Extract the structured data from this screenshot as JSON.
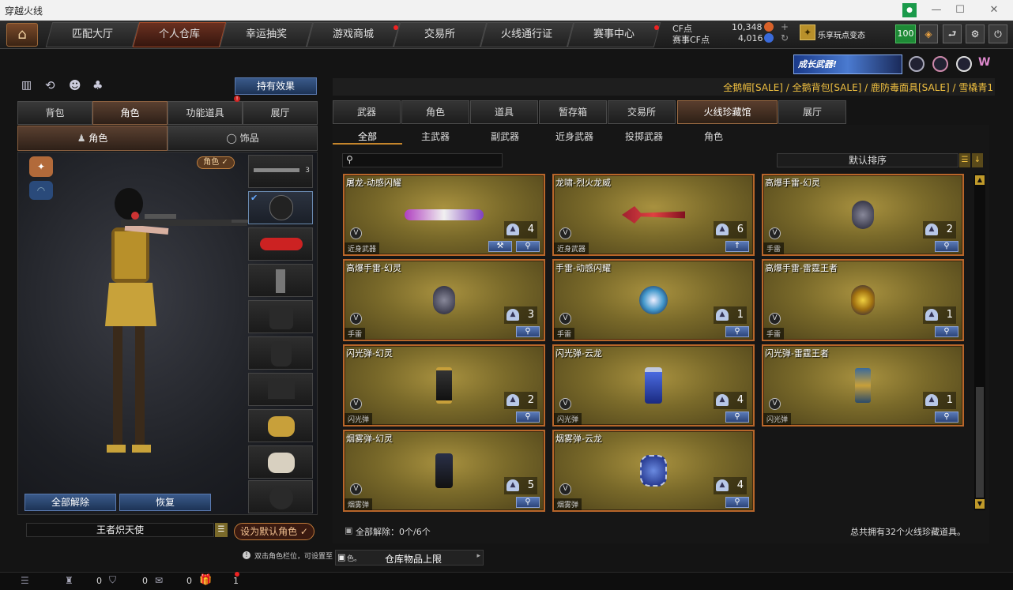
{
  "window": {
    "title": "穿越火线",
    "min": "—",
    "max": "☐",
    "close": "✕"
  },
  "nav": {
    "tabs": [
      {
        "label": "匹配大厅"
      },
      {
        "label": "个人仓库"
      },
      {
        "label": "幸运抽奖"
      },
      {
        "label": "游戏商城"
      },
      {
        "label": "交易所"
      },
      {
        "label": "火线通行证"
      },
      {
        "label": "赛事中心"
      }
    ],
    "active": 1,
    "cf_label": "CF点",
    "cf_value": "10,348",
    "saishi_label": "赛事CF点",
    "saishi_value": "4,016",
    "event_label": "乐享玩点变态",
    "level": "100",
    "banner": "成长武器!"
  },
  "marquee": "全鹅帽[SALE] / 全鹅背包[SALE] / 鹿防毒面具[SALE] / 雪橇青1",
  "left": {
    "effect_button": "持有效果",
    "tabs": [
      {
        "label": "背包"
      },
      {
        "label": "角色"
      },
      {
        "label": "功能道具"
      },
      {
        "label": "展厅"
      }
    ],
    "active_tab": 1,
    "subtabs": [
      {
        "label": "角色"
      },
      {
        "label": "饰品"
      }
    ],
    "char_badge": "角色 ✓",
    "unequip_all": "全部解除",
    "restore": "恢复",
    "character_name": "王者炽天使",
    "set_default": "设为默认角色 ✓",
    "hint": "双击角色栏位，可设置至",
    "hint2": "色。",
    "slot_number": "3"
  },
  "right": {
    "tabs": [
      {
        "label": "武器"
      },
      {
        "label": "角色"
      },
      {
        "label": "道具"
      },
      {
        "label": "暂存箱"
      },
      {
        "label": "交易所"
      },
      {
        "label": "火线珍藏馆"
      },
      {
        "label": "展厅"
      }
    ],
    "active_tab": 5,
    "subtabs": [
      {
        "label": "全部"
      },
      {
        "label": "主武器"
      },
      {
        "label": "副武器"
      },
      {
        "label": "近身武器"
      },
      {
        "label": "投掷武器"
      },
      {
        "label": "角色"
      }
    ],
    "active_subtab": 0,
    "sort_label": "默认排序",
    "items": [
      {
        "name": "屠龙-动感闪耀",
        "category": "近身武器",
        "count": "4",
        "icon": "melee-knife"
      },
      {
        "name": "龙啸-烈火龙威",
        "category": "近身武器",
        "count": "6",
        "icon": "melee-axe"
      },
      {
        "name": "高爆手雷-幻灵",
        "category": "手雷",
        "count": "2",
        "icon": "grenade"
      },
      {
        "name": "高爆手雷-幻灵",
        "category": "手雷",
        "count": "3",
        "icon": "grenade"
      },
      {
        "name": "手雷-动感闪耀",
        "category": "手雷",
        "count": "1",
        "icon": "disco-grenade"
      },
      {
        "name": "高爆手雷-雷霆王者",
        "category": "手雷",
        "count": "1",
        "icon": "gold-grenade"
      },
      {
        "name": "闪光弹-幻灵",
        "category": "闪光弹",
        "count": "2",
        "icon": "flash"
      },
      {
        "name": "闪光弹-云龙",
        "category": "闪光弹",
        "count": "4",
        "icon": "flash-blue"
      },
      {
        "name": "闪光弹-雷霆王者",
        "category": "闪光弹",
        "count": "1",
        "icon": "flash-gold"
      },
      {
        "name": "烟雾弹-幻灵",
        "category": "烟雾弹",
        "count": "5",
        "icon": "smoke"
      },
      {
        "name": "烟雾弹-云龙",
        "category": "烟雾弹",
        "count": "4",
        "icon": "smoke-blue"
      }
    ],
    "unequip_label": "全部解除：0个/6个",
    "total_label": "总共拥有32个火线珍藏道具。",
    "warehouse_limit": "仓库物品上限"
  },
  "bottom": {
    "count1": "0",
    "count2": "0",
    "count3": "0",
    "gift": "1"
  }
}
